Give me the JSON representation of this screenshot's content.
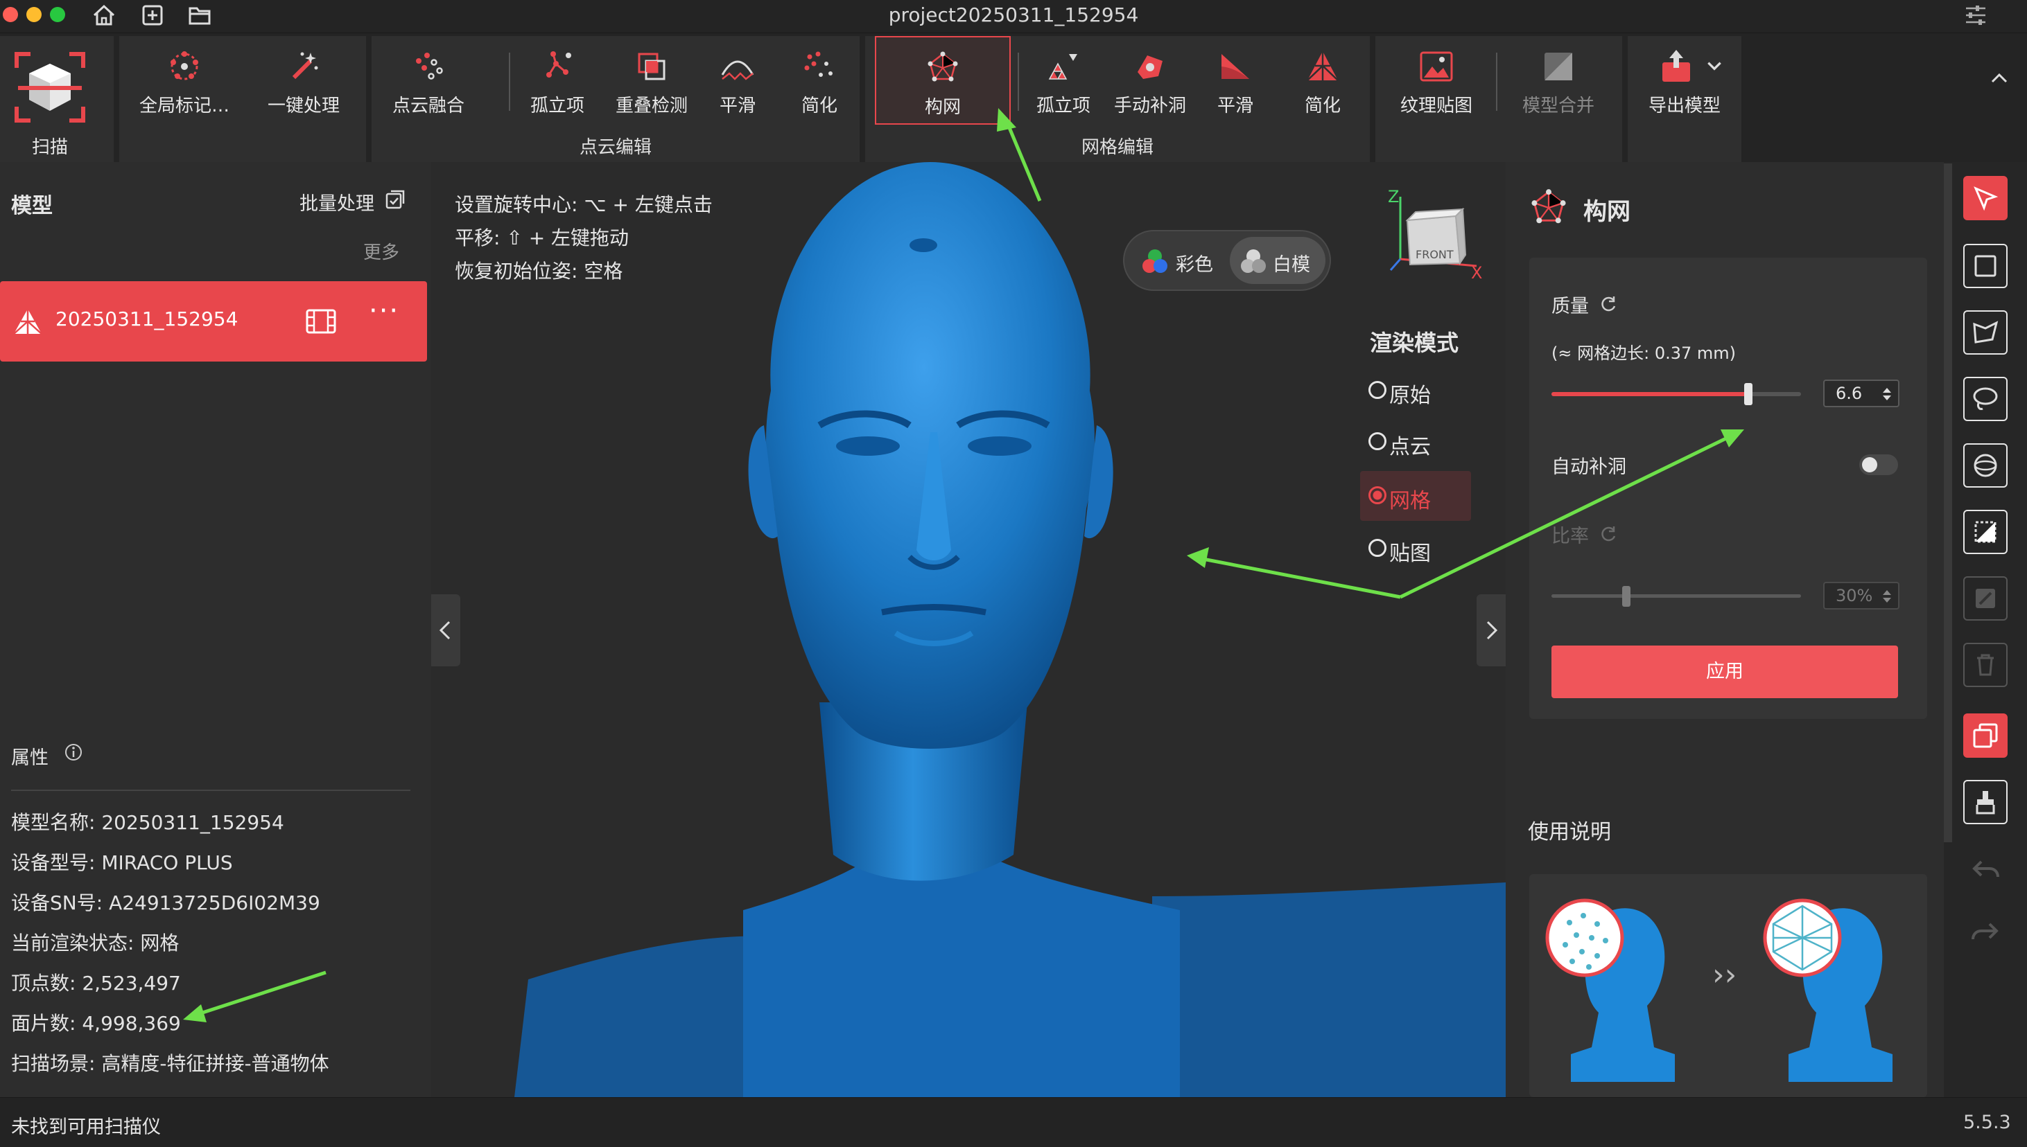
{
  "window": {
    "title": "project20250311_152954"
  },
  "toolbar": {
    "scan_label": "扫描",
    "global_mark_label": "全局标记…",
    "one_click_label": "一键处理",
    "pc_fusion_label": "点云融合",
    "pc_isolated_label": "孤立项",
    "pc_overlap_label": "重叠检测",
    "pc_smooth_label": "平滑",
    "pc_simplify_label": "简化",
    "pc_group_label": "点云编辑",
    "mesh_build_label": "构网",
    "mesh_isolated_label": "孤立项",
    "mesh_fill_label": "手动补洞",
    "mesh_smooth_label": "平滑",
    "mesh_simplify_label": "简化",
    "mesh_group_label": "网格编辑",
    "texture_label": "纹理贴图",
    "merge_label": "模型合并",
    "export_label": "导出模型"
  },
  "left_panel": {
    "title": "模型",
    "batch_label": "批量处理",
    "more_label": "更多",
    "model_item": "20250311_152954",
    "props_title": "属性",
    "props": [
      {
        "key": "模型名称",
        "value": "20250311_152954"
      },
      {
        "key": "设备型号",
        "value": "MIRACO PLUS"
      },
      {
        "key": "设备SN号",
        "value": "A24913725D6I02M39"
      },
      {
        "key": "当前渲染状态",
        "value": "网格"
      },
      {
        "key": "顶点数",
        "value": "2,523,497"
      },
      {
        "key": "面片数",
        "value": "4,998,369"
      },
      {
        "key": "扫描场景",
        "value": "高精度-特征拼接-普通物体"
      }
    ]
  },
  "viewport": {
    "hints": [
      "设置旋转中心: ⌥ + 左键点击",
      "平移: ⇧ + 左键拖动",
      "恢复初始位姿: 空格"
    ],
    "color_label": "彩色",
    "white_label": "白模",
    "render_mode_title": "渲染模式",
    "render_modes": [
      "原始",
      "点云",
      "网格",
      "贴图"
    ],
    "selected_mode": "网格",
    "axis_z": "Z",
    "axis_x": "X",
    "cube_face": "FRONT"
  },
  "right_panel": {
    "title": "构网",
    "quality_label": "质量",
    "edge_note": "(≈ 网格边长: 0.37 mm)",
    "quality_value": "6.6",
    "quality_fraction": 0.79,
    "auto_fill_label": "自动补洞",
    "auto_fill_on": false,
    "ratio_label": "比率",
    "ratio_value": "30%",
    "ratio_fraction": 0.3,
    "apply_label": "应用",
    "usage_title": "使用说明",
    "usage_arrow": "››"
  },
  "status": {
    "message": "未找到可用扫描仪",
    "version": "5.5.3"
  },
  "colors": {
    "accent": "#e8474c",
    "model_blue": "#1d7fcf",
    "annotation_green": "#6ee04a"
  }
}
